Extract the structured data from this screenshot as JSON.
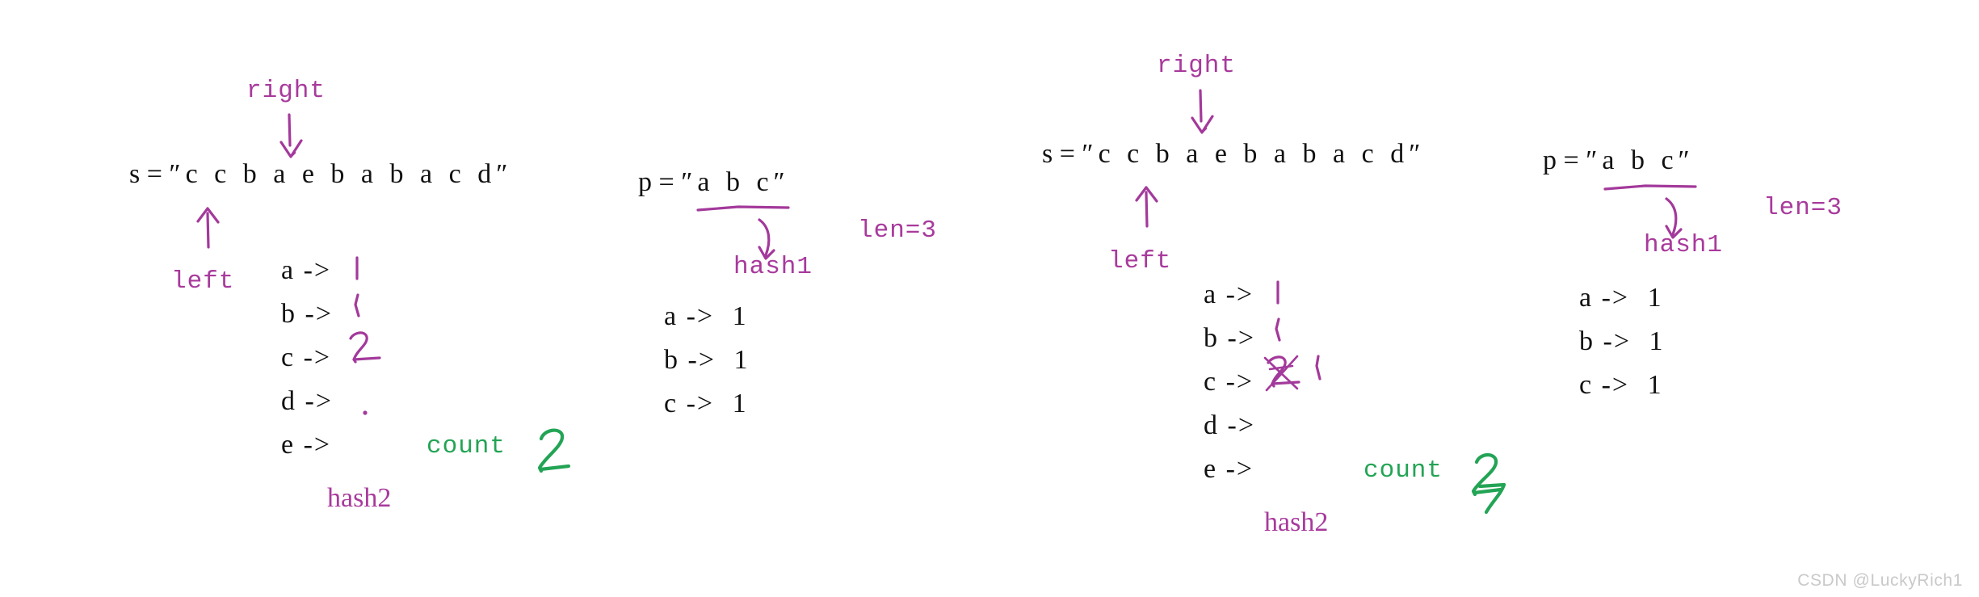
{
  "meta": {
    "watermark": "CSDN @LuckyRich1",
    "colors": {
      "ink_purple": "#a3399b",
      "ink_green": "#23a455",
      "text_black": "#111111",
      "watermark_gray": "#c9c9c9",
      "background": "#ffffff"
    }
  },
  "panels": [
    {
      "id": "left-panel",
      "s_line": {
        "label": "s = ",
        "value": "″c c b a e b a b a c d″",
        "pointer_right_label": "right",
        "pointer_left_label": "left"
      },
      "p_line": {
        "label": "p = ",
        "value": "″a b c″",
        "hash_label": "hash1",
        "len_label": "len=3"
      },
      "hash2": {
        "title": "hash2",
        "rows": [
          {
            "key": "a ->",
            "value": "1",
            "handwritten": true,
            "struck": false
          },
          {
            "key": "b ->",
            "value": "1",
            "handwritten": true,
            "struck": false
          },
          {
            "key": "c ->",
            "value": "2",
            "handwritten": true,
            "struck": false
          },
          {
            "key": "d ->",
            "value": "",
            "handwritten": false,
            "struck": false
          },
          {
            "key": "e ->",
            "value": ".",
            "handwritten": true,
            "struck": false
          }
        ]
      },
      "hash1": {
        "rows": [
          {
            "key": "a ->",
            "value": "1"
          },
          {
            "key": "b ->",
            "value": "1"
          },
          {
            "key": "c ->",
            "value": "1"
          }
        ]
      },
      "count": {
        "label": "count",
        "value": "2",
        "handwritten": true
      }
    },
    {
      "id": "right-panel",
      "s_line": {
        "label": "s = ",
        "value": "″c c b a e b a b a c d″",
        "pointer_right_label": "right",
        "pointer_left_label": "left"
      },
      "p_line": {
        "label": "p = ",
        "value": "″a b c″",
        "hash_label": "hash1",
        "len_label": "len=3"
      },
      "hash2": {
        "title": "hash2",
        "rows": [
          {
            "key": "a ->",
            "value": "1",
            "handwritten": true,
            "struck": false
          },
          {
            "key": "b ->",
            "value": "1",
            "handwritten": true,
            "struck": false
          },
          {
            "key": "c ->",
            "value": "2",
            "new_value": "1",
            "handwritten": true,
            "struck": true
          },
          {
            "key": "d ->",
            "value": "",
            "handwritten": false,
            "struck": false
          },
          {
            "key": "e ->",
            "value": ".",
            "handwritten": true,
            "struck": false
          }
        ]
      },
      "hash1": {
        "rows": [
          {
            "key": "a ->",
            "value": "1"
          },
          {
            "key": "b ->",
            "value": "1"
          },
          {
            "key": "c ->",
            "value": "1"
          }
        ]
      },
      "count": {
        "label": "count",
        "value": "2",
        "new_value": "3",
        "handwritten": true,
        "struck": true
      }
    }
  ]
}
